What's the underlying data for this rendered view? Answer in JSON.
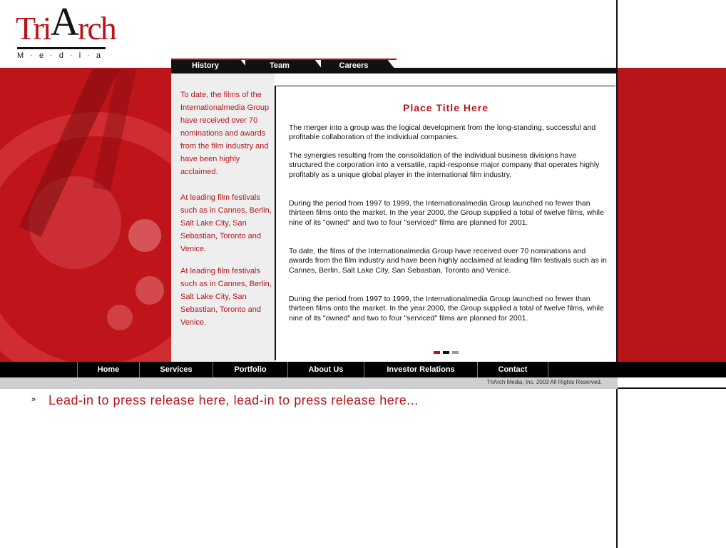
{
  "logo": {
    "word_prefix": "Tri",
    "word_A": "A",
    "word_suffix": "rch",
    "tagline": "M · e · d · i · a"
  },
  "tabs": [
    {
      "label": "History"
    },
    {
      "label": "Team"
    },
    {
      "label": "Careers"
    }
  ],
  "sidebar": {
    "blocks": [
      "To date, the films of the Internationalmedia Group have received over 70 nominations and awards from the film industry and have been highly acclaimed.",
      "At leading film festivals such as in Cannes, Berlin, Salt Lake City, San Sebastian, Toronto and Venice.",
      "At leading film festivals such as in Cannes, Berlin, Salt Lake City, San Sebastian, Toronto and Venice."
    ]
  },
  "content": {
    "title": "Place Title Here",
    "paragraphs": [
      "The merger into a group was the logical development from the long-standing, successful and profitable collaboration of the individual companies.",
      "The synergies resulting from the consolidation of the individual business divisions have structured the corporation into a versatile, rapid-response major company that operates highly profitably as a unique global player in the international film industry.",
      "During the period from 1997 to 1999, the Internationalmedia Group launched no fewer than thirteen films onto the market. In the year 2000, the Group supplied a total of twelve films, while nine of its \"owned\" and two to four \"serviced\" films are planned for 2001.",
      "To date, the films of the Internationalmedia Group have received over 70 nominations and awards from the film industry and have been highly acclaimed at leading film festivals such as in Cannes, Berlin, Salt Lake City, San Sebastian, Toronto and Venice.",
      "During the period from 1997 to 1999, the Internationalmedia Group launched no fewer than thirteen films onto the market. In the year 2000, the Group supplied a total of twelve films, while nine of its \"owned\" and two to four \"serviced\" films are planned for 2001."
    ],
    "pager_colors": [
      "#b8151b",
      "#111111",
      "#9a9a9a"
    ]
  },
  "nav": [
    {
      "label": "Home"
    },
    {
      "label": "Services"
    },
    {
      "label": "Portfolio"
    },
    {
      "label": "About Us"
    },
    {
      "label": "Investor Relations"
    },
    {
      "label": "Contact"
    }
  ],
  "footer": {
    "copyright": "TriArch Media, Inc.  2003   All Rights Reserved."
  },
  "lead_in": {
    "icon": "double-chevron-right-icon",
    "text": "Lead-in to press release here, lead-in to press release here..."
  },
  "colors": {
    "accent": "#b8151b",
    "dark": "#111111",
    "sidebar_bg": "#eeeeee",
    "footer_bg": "#cfcfcf"
  }
}
